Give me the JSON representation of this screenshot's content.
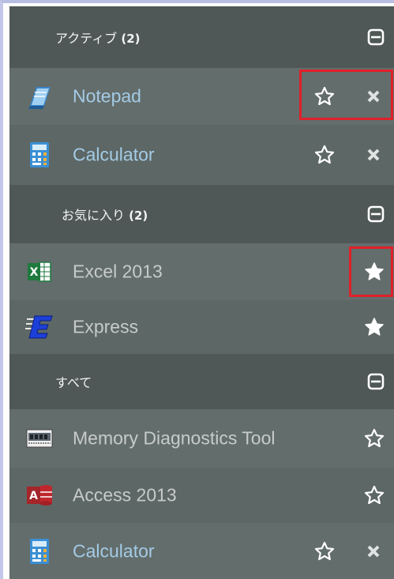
{
  "groups": {
    "active": {
      "label": "アクティブ",
      "count": "(2)"
    },
    "favorites": {
      "label": "お気に入り",
      "count": "(2)"
    },
    "all": {
      "label": "すべて"
    }
  },
  "items": {
    "notepad": {
      "label": "Notepad",
      "icon": "notepad-icon",
      "starred": false,
      "closable": true
    },
    "calculator": {
      "label": "Calculator",
      "icon": "calculator-icon",
      "starred": false,
      "closable": true
    },
    "excel": {
      "label": "Excel 2013",
      "icon": "excel-icon",
      "starred": true
    },
    "express": {
      "label": "Express",
      "icon": "express-icon",
      "starred": true
    },
    "memory": {
      "label": "Memory Diagnostics Tool",
      "icon": "memory-diagnostics-icon",
      "starred": false
    },
    "access": {
      "label": "Access 2013",
      "icon": "access-icon",
      "starred": false
    },
    "calculator2": {
      "label": "Calculator",
      "icon": "calculator-icon",
      "starred": false,
      "closable": true
    }
  },
  "colors": {
    "header_bg": "#4f5856",
    "item_bg": "#636d6b",
    "running_label": "#a4cbe6",
    "idle_label": "#c6cbca",
    "highlight": "#e0202a"
  }
}
